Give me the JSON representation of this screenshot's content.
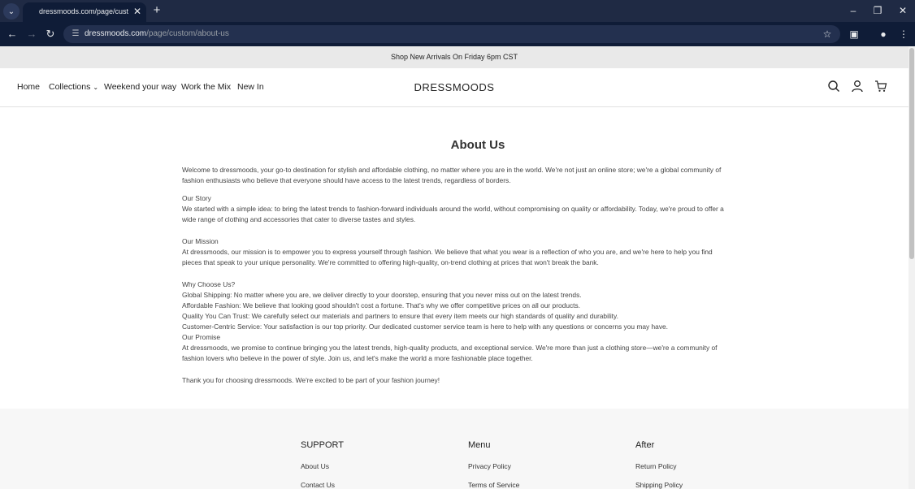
{
  "browser": {
    "tab_title": "dressmoods.com/page/custom/",
    "url_host": "dressmoods.com",
    "url_path": "/page/custom/about-us"
  },
  "announcement": "Shop New Arrivals On Friday 6pm CST",
  "nav": {
    "home": "Home",
    "collections": "Collections",
    "weekend": "Weekend your way",
    "work": "Work the Mix",
    "new_in": "New In"
  },
  "brand": "DRESSMOODS",
  "page": {
    "title": "About Us",
    "intro": "Welcome to dressmoods, your go-to destination for stylish and affordable clothing, no matter where you are in the world. We're not just an online store; we're a global community of fashion enthusiasts who believe that everyone should have access to the latest trends, regardless of borders.",
    "story_heading": "Our Story",
    "story_text": "We started with a simple idea: to bring the latest trends to fashion-forward individuals around the world, without compromising on quality or affordability. Today, we're proud to offer a wide range of clothing and accessories that cater to diverse tastes and styles.",
    "mission_heading": "Our Mission",
    "mission_text": "At dressmoods, our mission is to empower you to express yourself through fashion. We believe that what you wear is a reflection of who you are, and we're here to help you find pieces that speak to your unique personality. We're committed to offering high-quality, on-trend clothing at prices that won't break the bank.",
    "why_heading": "Why Choose Us?",
    "why_items": [
      "Global Shipping: No matter where you are, we deliver directly to your doorstep, ensuring that you never miss out on the latest trends.",
      "Affordable Fashion: We believe that looking good shouldn't cost a fortune. That's why we offer competitive prices on all our products.",
      "Quality You Can Trust: We carefully select our materials and partners to ensure that every item meets our high standards of quality and durability.",
      "Customer-Centric Service: Your satisfaction is our top priority. Our dedicated customer service team is here to help with any questions or concerns you may have."
    ],
    "promise_heading": "Our Promise",
    "promise_text": "At dressmoods, we promise to continue bringing you the latest trends, high-quality products, and exceptional service. We're more than just a clothing store—we're a community of fashion lovers who believe in the power of style. Join us, and let's make the world a more fashionable place together.",
    "thanks": "Thank you for choosing dressmoods. We're excited to be part of your fashion journey!"
  },
  "footer": {
    "support": {
      "title": "SUPPORT",
      "links": [
        "About Us",
        "Contact Us"
      ]
    },
    "menu": {
      "title": "Menu",
      "links": [
        "Privacy Policy",
        "Terms of Service"
      ]
    },
    "after": {
      "title": "After",
      "links": [
        "Return Policy",
        "Shipping Policy"
      ]
    }
  }
}
